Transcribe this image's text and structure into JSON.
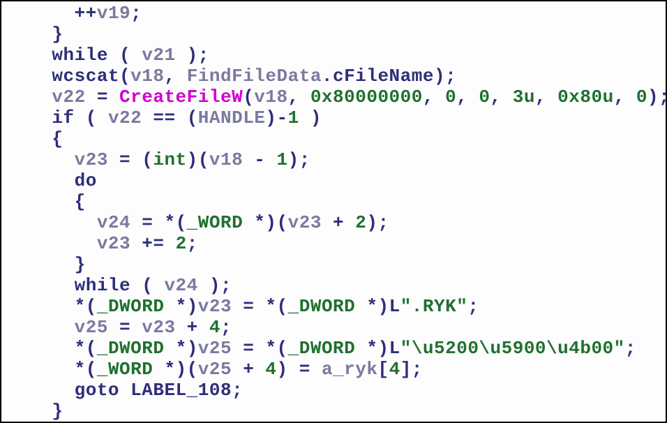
{
  "code": {
    "lines": [
      {
        "indent": 3,
        "tokens": [
          {
            "t": "op",
            "v": "++"
          },
          {
            "t": "id",
            "v": "v19"
          },
          {
            "t": "punc",
            "v": ";"
          }
        ]
      },
      {
        "indent": 2,
        "tokens": [
          {
            "t": "punc",
            "v": "}"
          }
        ]
      },
      {
        "indent": 2,
        "tokens": [
          {
            "t": "kw",
            "v": "while"
          },
          {
            "t": "punc",
            "v": " ( "
          },
          {
            "t": "id",
            "v": "v21"
          },
          {
            "t": "punc",
            "v": " );"
          }
        ]
      },
      {
        "indent": 2,
        "tokens": [
          {
            "t": "kw",
            "v": "wcscat"
          },
          {
            "t": "punc",
            "v": "("
          },
          {
            "t": "id",
            "v": "v18"
          },
          {
            "t": "punc",
            "v": ", "
          },
          {
            "t": "id",
            "v": "FindFileData"
          },
          {
            "t": "punc",
            "v": "."
          },
          {
            "t": "memb",
            "v": "cFileName"
          },
          {
            "t": "punc",
            "v": ");"
          }
        ]
      },
      {
        "indent": 2,
        "tokens": [
          {
            "t": "id",
            "v": "v22"
          },
          {
            "t": "op",
            "v": " = "
          },
          {
            "t": "func",
            "v": "CreateFileW"
          },
          {
            "t": "punc",
            "v": "("
          },
          {
            "t": "id",
            "v": "v18"
          },
          {
            "t": "punc",
            "v": ", "
          },
          {
            "t": "num",
            "v": "0x80000000"
          },
          {
            "t": "punc",
            "v": ", "
          },
          {
            "t": "num",
            "v": "0"
          },
          {
            "t": "punc",
            "v": ", "
          },
          {
            "t": "num",
            "v": "0"
          },
          {
            "t": "punc",
            "v": ", "
          },
          {
            "t": "num",
            "v": "3u"
          },
          {
            "t": "punc",
            "v": ", "
          },
          {
            "t": "num",
            "v": "0x80u"
          },
          {
            "t": "punc",
            "v": ", "
          },
          {
            "t": "num",
            "v": "0"
          },
          {
            "t": "punc",
            "v": ");"
          }
        ]
      },
      {
        "indent": 2,
        "tokens": [
          {
            "t": "kw",
            "v": "if"
          },
          {
            "t": "punc",
            "v": " ( "
          },
          {
            "t": "id",
            "v": "v22"
          },
          {
            "t": "op",
            "v": " == "
          },
          {
            "t": "punc",
            "v": "("
          },
          {
            "t": "id",
            "v": "HANDLE"
          },
          {
            "t": "punc",
            "v": ")"
          },
          {
            "t": "op",
            "v": "-"
          },
          {
            "t": "num",
            "v": "1"
          },
          {
            "t": "punc",
            "v": " )"
          }
        ]
      },
      {
        "indent": 2,
        "tokens": [
          {
            "t": "punc",
            "v": "{"
          }
        ]
      },
      {
        "indent": 3,
        "tokens": [
          {
            "t": "id",
            "v": "v23"
          },
          {
            "t": "op",
            "v": " = "
          },
          {
            "t": "punc",
            "v": "("
          },
          {
            "t": "type",
            "v": "int"
          },
          {
            "t": "punc",
            "v": ")("
          },
          {
            "t": "id",
            "v": "v18"
          },
          {
            "t": "op",
            "v": " - "
          },
          {
            "t": "num",
            "v": "1"
          },
          {
            "t": "punc",
            "v": ");"
          }
        ]
      },
      {
        "indent": 3,
        "tokens": [
          {
            "t": "kw",
            "v": "do"
          }
        ]
      },
      {
        "indent": 3,
        "tokens": [
          {
            "t": "punc",
            "v": "{"
          }
        ]
      },
      {
        "indent": 4,
        "tokens": [
          {
            "t": "id",
            "v": "v24"
          },
          {
            "t": "op",
            "v": " = *"
          },
          {
            "t": "punc",
            "v": "("
          },
          {
            "t": "type",
            "v": "_WORD"
          },
          {
            "t": "op",
            "v": " *"
          },
          {
            "t": "punc",
            "v": ")("
          },
          {
            "t": "id",
            "v": "v23"
          },
          {
            "t": "op",
            "v": " + "
          },
          {
            "t": "num",
            "v": "2"
          },
          {
            "t": "punc",
            "v": ");"
          }
        ]
      },
      {
        "indent": 4,
        "tokens": [
          {
            "t": "id",
            "v": "v23"
          },
          {
            "t": "op",
            "v": " += "
          },
          {
            "t": "num",
            "v": "2"
          },
          {
            "t": "punc",
            "v": ";"
          }
        ]
      },
      {
        "indent": 3,
        "tokens": [
          {
            "t": "punc",
            "v": "}"
          }
        ]
      },
      {
        "indent": 3,
        "tokens": [
          {
            "t": "kw",
            "v": "while"
          },
          {
            "t": "punc",
            "v": " ( "
          },
          {
            "t": "id",
            "v": "v24"
          },
          {
            "t": "punc",
            "v": " );"
          }
        ]
      },
      {
        "indent": 3,
        "tokens": [
          {
            "t": "op",
            "v": "*"
          },
          {
            "t": "punc",
            "v": "("
          },
          {
            "t": "type",
            "v": "_DWORD"
          },
          {
            "t": "op",
            "v": " *"
          },
          {
            "t": "punc",
            "v": ")"
          },
          {
            "t": "id",
            "v": "v23"
          },
          {
            "t": "op",
            "v": " = *"
          },
          {
            "t": "punc",
            "v": "("
          },
          {
            "t": "type",
            "v": "_DWORD"
          },
          {
            "t": "op",
            "v": " *"
          },
          {
            "t": "punc",
            "v": ")"
          },
          {
            "t": "kw",
            "v": "L"
          },
          {
            "t": "str",
            "v": "\".RYK\""
          },
          {
            "t": "punc",
            "v": ";"
          }
        ]
      },
      {
        "indent": 3,
        "tokens": [
          {
            "t": "id",
            "v": "v25"
          },
          {
            "t": "op",
            "v": " = "
          },
          {
            "t": "id",
            "v": "v23"
          },
          {
            "t": "op",
            "v": " + "
          },
          {
            "t": "num",
            "v": "4"
          },
          {
            "t": "punc",
            "v": ";"
          }
        ]
      },
      {
        "indent": 3,
        "tokens": [
          {
            "t": "op",
            "v": "*"
          },
          {
            "t": "punc",
            "v": "("
          },
          {
            "t": "type",
            "v": "_DWORD"
          },
          {
            "t": "op",
            "v": " *"
          },
          {
            "t": "punc",
            "v": ")"
          },
          {
            "t": "id",
            "v": "v25"
          },
          {
            "t": "op",
            "v": " = *"
          },
          {
            "t": "punc",
            "v": "("
          },
          {
            "t": "type",
            "v": "_DWORD"
          },
          {
            "t": "op",
            "v": " *"
          },
          {
            "t": "punc",
            "v": ")"
          },
          {
            "t": "kw",
            "v": "L"
          },
          {
            "t": "str",
            "v": "\"\\u5200\\u5900\\u4b00\""
          },
          {
            "t": "punc",
            "v": ";"
          }
        ]
      },
      {
        "indent": 3,
        "tokens": [
          {
            "t": "op",
            "v": "*"
          },
          {
            "t": "punc",
            "v": "("
          },
          {
            "t": "type",
            "v": "_WORD"
          },
          {
            "t": "op",
            "v": " *"
          },
          {
            "t": "punc",
            "v": ")("
          },
          {
            "t": "id",
            "v": "v25"
          },
          {
            "t": "op",
            "v": " + "
          },
          {
            "t": "num",
            "v": "4"
          },
          {
            "t": "punc",
            "v": ") = "
          },
          {
            "t": "id",
            "v": "a_ryk"
          },
          {
            "t": "punc",
            "v": "["
          },
          {
            "t": "num",
            "v": "4"
          },
          {
            "t": "punc",
            "v": "];"
          }
        ]
      },
      {
        "indent": 3,
        "tokens": [
          {
            "t": "kw",
            "v": "goto"
          },
          {
            "t": "punc",
            "v": " "
          },
          {
            "t": "kw",
            "v": "LABEL_108"
          },
          {
            "t": "punc",
            "v": ";"
          }
        ]
      },
      {
        "indent": 2,
        "tokens": [
          {
            "t": "punc",
            "v": "}"
          }
        ]
      }
    ]
  }
}
